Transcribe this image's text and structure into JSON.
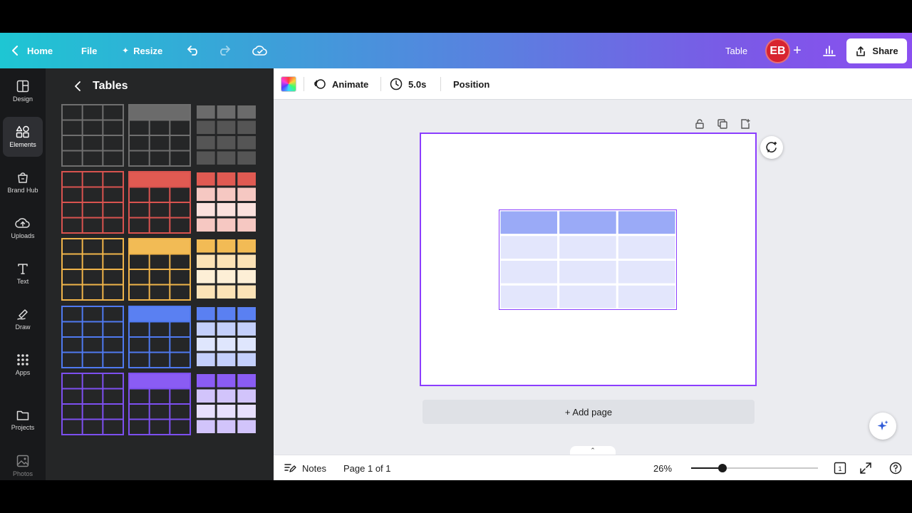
{
  "header": {
    "home_label": "Home",
    "file_label": "File",
    "resize_label": "Resize",
    "design_title": "Table",
    "avatar_initials": "EB",
    "share_label": "Share",
    "gradient_colors": [
      "#1ec6d3",
      "#8a4ff0"
    ]
  },
  "rail": {
    "items": [
      {
        "label": "Design",
        "icon": "design-icon"
      },
      {
        "label": "Elements",
        "icon": "elements-icon",
        "active": true
      },
      {
        "label": "Brand Hub",
        "icon": "brand-hub-icon"
      },
      {
        "label": "Uploads",
        "icon": "uploads-icon"
      },
      {
        "label": "Text",
        "icon": "text-icon"
      },
      {
        "label": "Draw",
        "icon": "draw-icon"
      },
      {
        "label": "Apps",
        "icon": "apps-icon"
      },
      {
        "label": "Projects",
        "icon": "projects-icon"
      },
      {
        "label": "Photos",
        "icon": "photos-icon"
      }
    ]
  },
  "panel": {
    "title": "Tables",
    "palettes": [
      {
        "name": "gray",
        "line": "#6f6f6f",
        "header": "#6b6b6b",
        "fills": [
          "#6b6b6b",
          "#555555"
        ]
      },
      {
        "name": "red",
        "line": "#d9534f",
        "header": "#e05a52",
        "fills": [
          "#e05a52",
          "#f6c8c2",
          "#fbe1dd"
        ]
      },
      {
        "name": "yellow",
        "line": "#f0b449",
        "header": "#f2bb55",
        "fills": [
          "#f2bb55",
          "#fbe2b6",
          "#fdefd6"
        ]
      },
      {
        "name": "blue",
        "line": "#4f79f0",
        "header": "#5a80f2",
        "fills": [
          "#5a80f2",
          "#c3cffb",
          "#dfe6fd"
        ]
      },
      {
        "name": "purple",
        "line": "#7d4ff0",
        "header": "#8a5cf4",
        "fills": [
          "#8a5cf4",
          "#d2c4fb",
          "#e8e0fd"
        ]
      }
    ]
  },
  "toolbar": {
    "animate_label": "Animate",
    "duration_label": "5.0s",
    "position_label": "Position"
  },
  "canvas": {
    "add_page_label": "+ Add page",
    "selection_color": "#8b3dff",
    "table": {
      "rows": 4,
      "cols": 3,
      "header_color": "#9aaaf7",
      "body_color": "#e3e6fc"
    }
  },
  "footer": {
    "notes_label": "Notes",
    "page_label": "Page 1 of 1",
    "zoom_label": "26%",
    "zoom_fraction": 0.26,
    "page_count": "1"
  }
}
